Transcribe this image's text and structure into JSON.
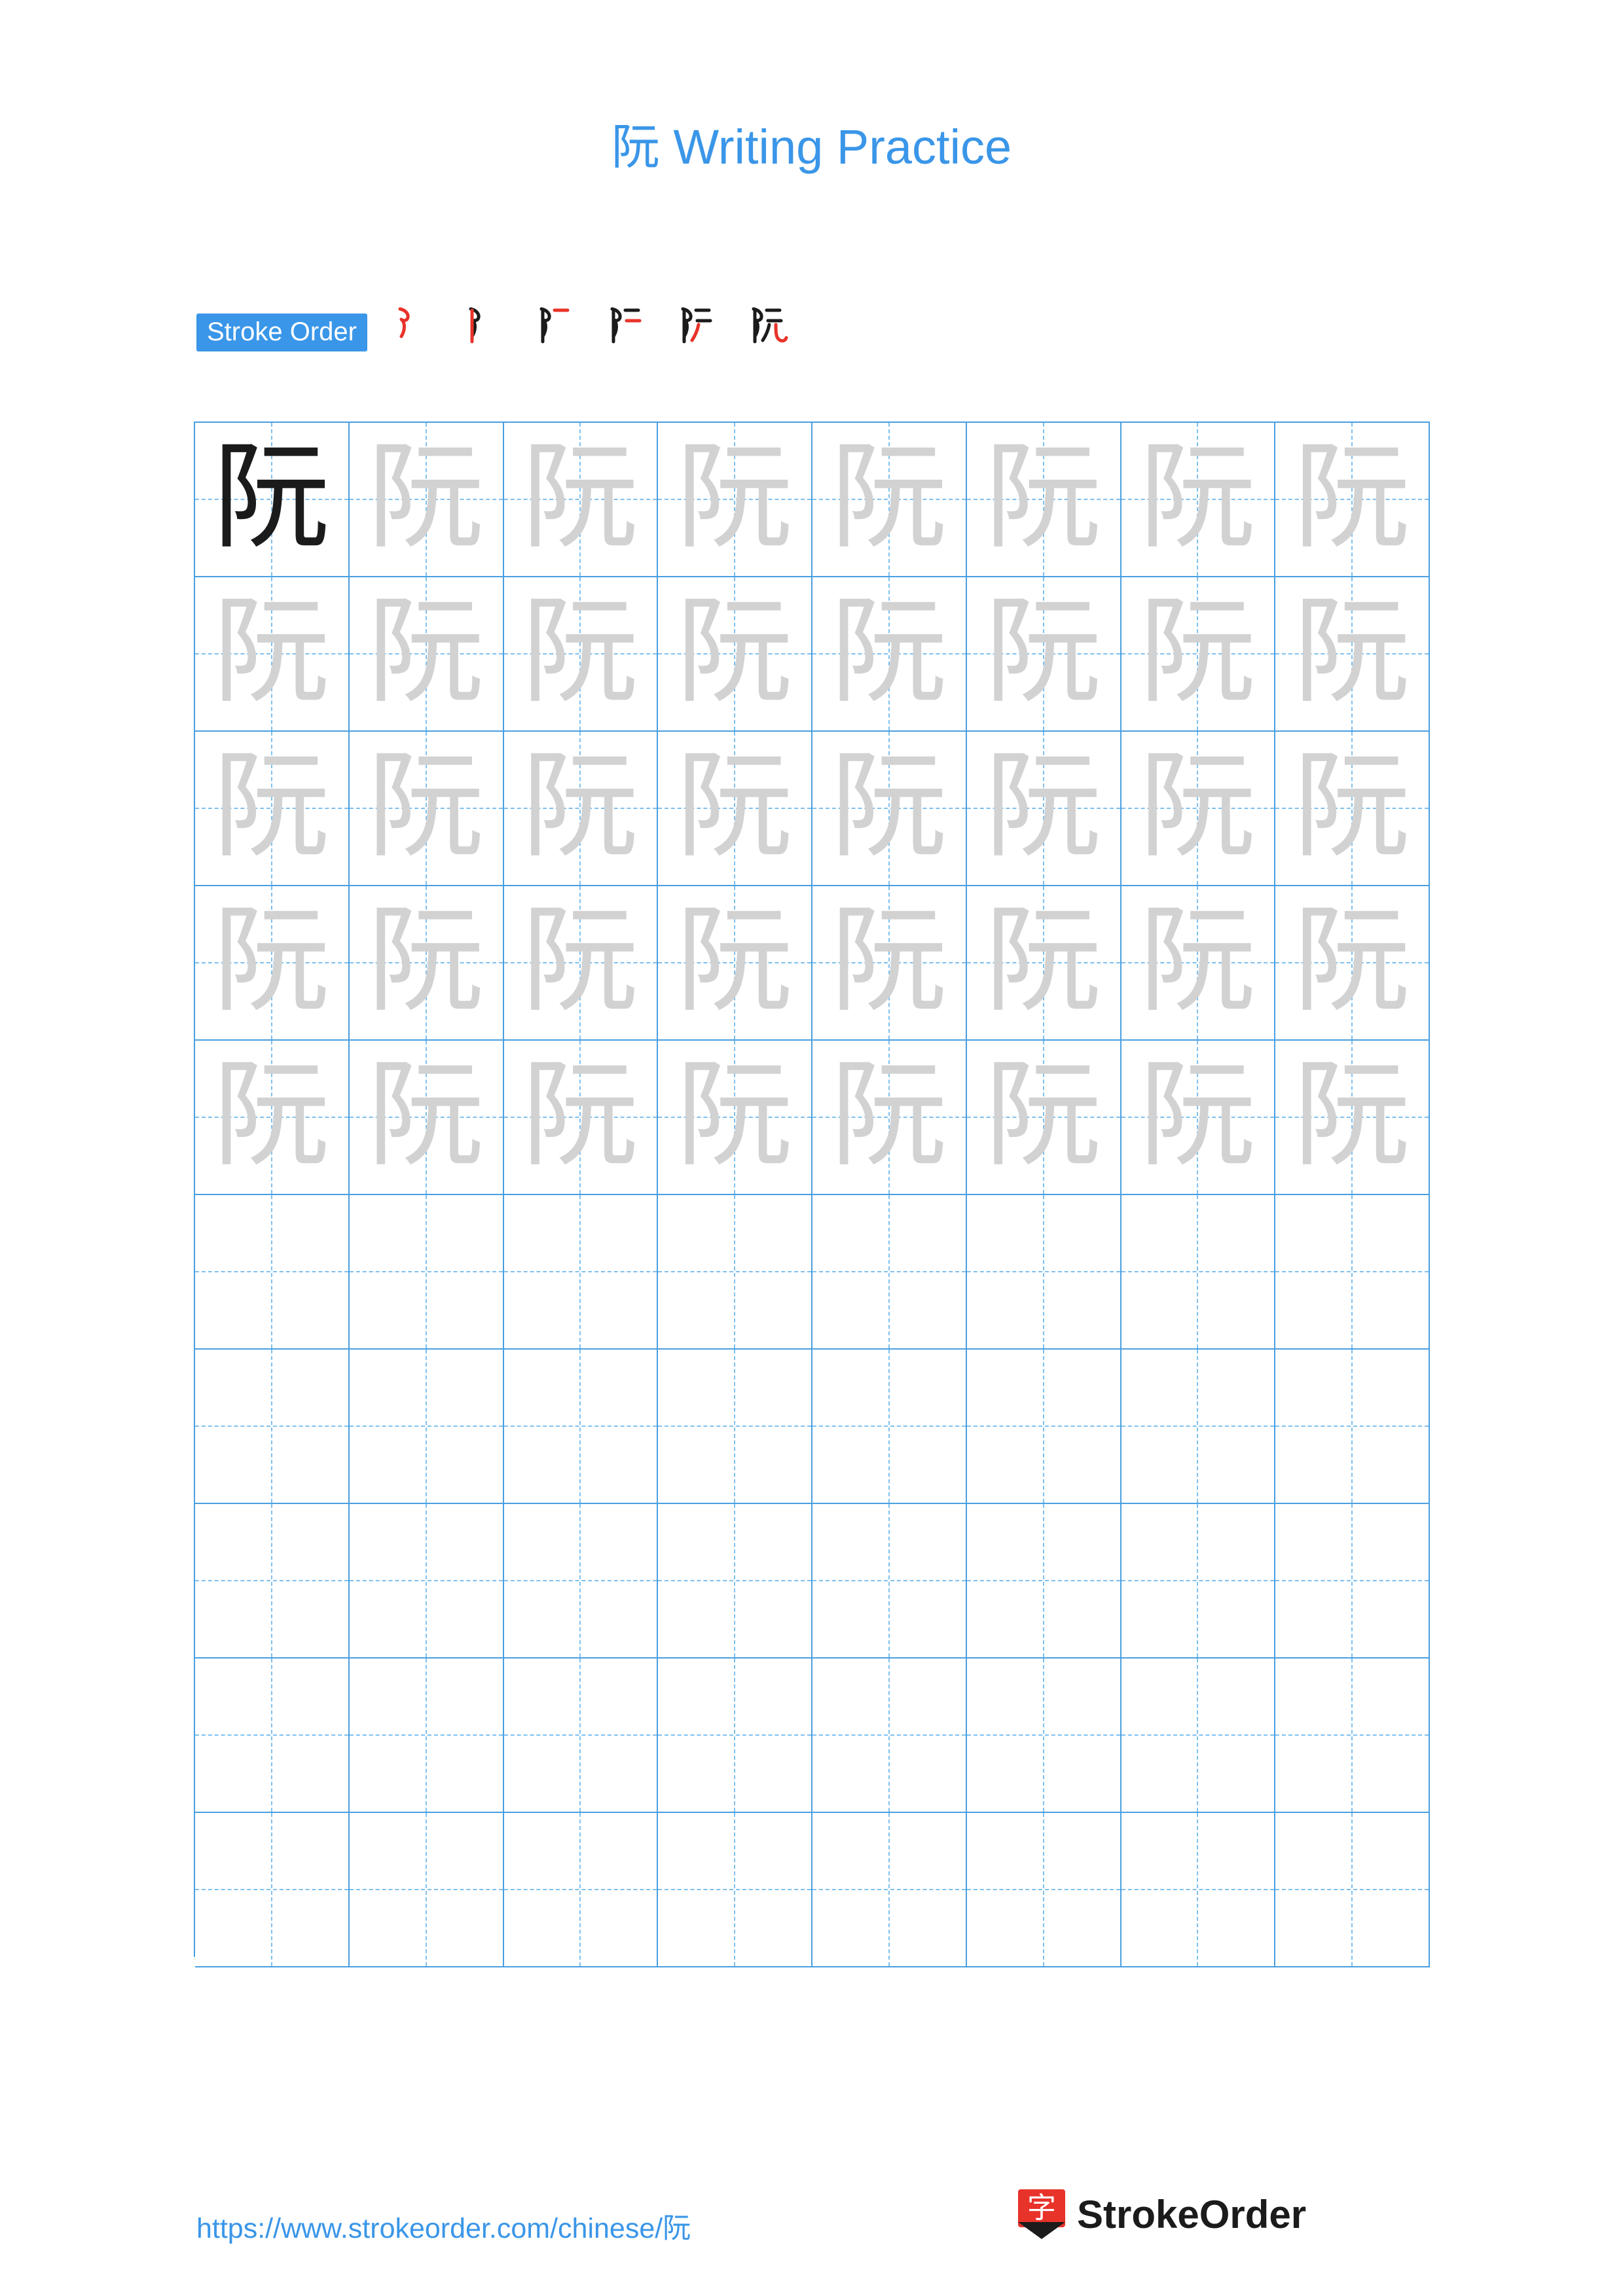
{
  "document": {
    "title": "阮 Writing Practice",
    "character": "阮",
    "stroke_order": {
      "label": "Stroke Order",
      "steps": [
        "阝",
        "阝",
        "阝",
        "阮",
        "阮",
        "阮"
      ],
      "step_count": 6
    },
    "practice_grid": {
      "columns": 8,
      "rows": 10,
      "cells": [
        [
          "solid",
          "ghost",
          "ghost",
          "ghost",
          "ghost",
          "ghost",
          "ghost",
          "ghost"
        ],
        [
          "ghost",
          "ghost",
          "ghost",
          "ghost",
          "ghost",
          "ghost",
          "ghost",
          "ghost"
        ],
        [
          "ghost",
          "ghost",
          "ghost",
          "ghost",
          "ghost",
          "ghost",
          "ghost",
          "ghost"
        ],
        [
          "ghost",
          "ghost",
          "ghost",
          "ghost",
          "ghost",
          "ghost",
          "ghost",
          "ghost"
        ],
        [
          "ghost",
          "ghost",
          "ghost",
          "ghost",
          "ghost",
          "ghost",
          "ghost",
          "ghost"
        ],
        [
          "empty",
          "empty",
          "empty",
          "empty",
          "empty",
          "empty",
          "empty",
          "empty"
        ],
        [
          "empty",
          "empty",
          "empty",
          "empty",
          "empty",
          "empty",
          "empty",
          "empty"
        ],
        [
          "empty",
          "empty",
          "empty",
          "empty",
          "empty",
          "empty",
          "empty",
          "empty"
        ],
        [
          "empty",
          "empty",
          "empty",
          "empty",
          "empty",
          "empty",
          "empty",
          "empty"
        ],
        [
          "empty",
          "empty",
          "empty",
          "empty",
          "empty",
          "empty",
          "empty",
          "empty"
        ]
      ]
    },
    "footer": {
      "url": "https://www.strokeorder.com/chinese/阮",
      "brand_name": "StrokeOrder",
      "brand_logo_char": "字"
    },
    "colors": {
      "accent_blue": "#3a96e8",
      "grid_line": "#4a9fe0",
      "grid_dash": "#7fc0ee",
      "ghost_char": "#d2d2d2",
      "solid_char": "#1b1b1b",
      "new_stroke_red": "#e8332a",
      "logo_red": "#e8332a"
    }
  }
}
